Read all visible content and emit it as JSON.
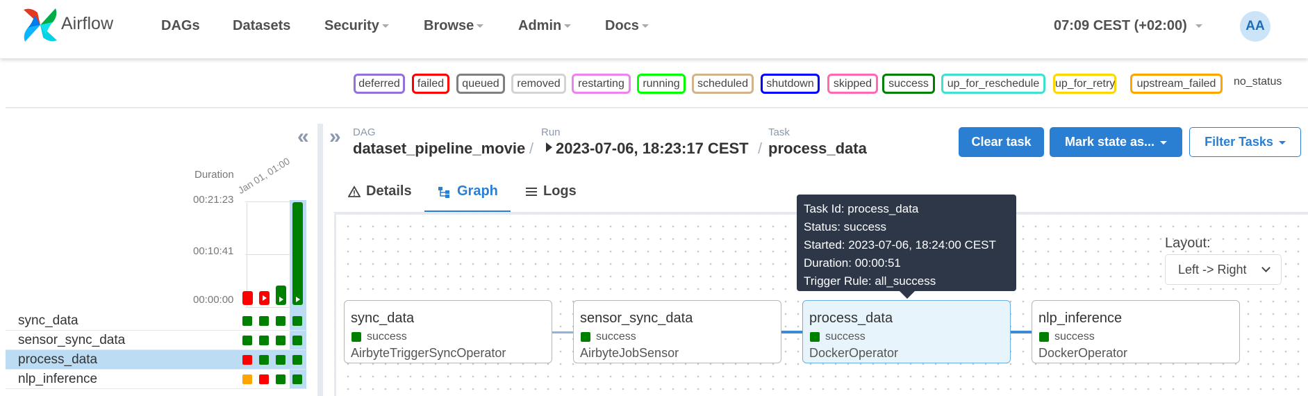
{
  "brand": {
    "name": "Airflow"
  },
  "nav": {
    "items": [
      {
        "label": "DAGs",
        "dropdown": false
      },
      {
        "label": "Datasets",
        "dropdown": false
      },
      {
        "label": "Security",
        "dropdown": true
      },
      {
        "label": "Browse",
        "dropdown": true
      },
      {
        "label": "Admin",
        "dropdown": true
      },
      {
        "label": "Docs",
        "dropdown": true
      }
    ],
    "clock": "07:09 CEST (+02:00)",
    "avatar_initials": "AA"
  },
  "legend": [
    {
      "label": "deferred",
      "color": "#9370db"
    },
    {
      "label": "failed",
      "color": "#ff0000"
    },
    {
      "label": "queued",
      "color": "#808080"
    },
    {
      "label": "removed",
      "color": "#d3d3d3"
    },
    {
      "label": "restarting",
      "color": "#ee82ee"
    },
    {
      "label": "running",
      "color": "#00ff00"
    },
    {
      "label": "scheduled",
      "color": "#d2b48c"
    },
    {
      "label": "shutdown",
      "color": "#0000ff"
    },
    {
      "label": "skipped",
      "color": "#ff69b4"
    },
    {
      "label": "success",
      "color": "#008000"
    },
    {
      "label": "up_for_reschedule",
      "color": "#40e0d0"
    },
    {
      "label": "up_for_retry",
      "color": "#ffd700"
    },
    {
      "label": "upstream_failed",
      "color": "#ffa500"
    },
    {
      "label": "no_status",
      "color": ""
    }
  ],
  "grid": {
    "duration_label": "Duration",
    "run_date_label": "Jan 01, 01:00",
    "ticks": [
      "00:21:23",
      "00:10:41",
      "00:00:00"
    ],
    "tasks": [
      {
        "name": "sync_data",
        "statuses": [
          "success",
          "success",
          "success",
          "success"
        ]
      },
      {
        "name": "sensor_sync_data",
        "statuses": [
          "success",
          "success",
          "success",
          "success"
        ]
      },
      {
        "name": "process_data",
        "statuses": [
          "failed",
          "success",
          "success",
          "success"
        ]
      },
      {
        "name": "nlp_inference",
        "statuses": [
          "upstream_failed",
          "failed",
          "success",
          "success"
        ]
      }
    ],
    "selected_task": "process_data",
    "status_colors": {
      "success": "#008000",
      "failed": "#ff0000",
      "upstream_failed": "#ffa500"
    }
  },
  "breadcrumb": {
    "dag_label": "DAG",
    "dag_value": "dataset_pipeline_movie",
    "run_label": "Run",
    "run_value": "2023-07-06, 18:23:17 CEST",
    "task_label": "Task",
    "task_value": "process_data"
  },
  "actions": {
    "clear": "Clear task",
    "mark": "Mark state as...",
    "filter": "Filter Tasks"
  },
  "tabs": [
    {
      "label": "Details",
      "icon": "warning-triangle-icon"
    },
    {
      "label": "Graph",
      "icon": "graph-icon",
      "active": true
    },
    {
      "label": "Logs",
      "icon": "list-lines-icon"
    }
  ],
  "graph": {
    "layout_label": "Layout:",
    "layout_value": "Left -> Right",
    "nodes": [
      {
        "title": "sync_data",
        "status": "success",
        "operator": "AirbyteTriggerSyncOperator"
      },
      {
        "title": "sensor_sync_data",
        "status": "success",
        "operator": "AirbyteJobSensor"
      },
      {
        "title": "process_data",
        "status": "success",
        "operator": "DockerOperator",
        "selected": true
      },
      {
        "title": "nlp_inference",
        "status": "success",
        "operator": "DockerOperator"
      }
    ],
    "tooltip": {
      "task_id": "Task Id: process_data",
      "status": "Status: success",
      "started": "Started: 2023-07-06, 18:24:00 CEST",
      "duration": "Duration: 00:00:51",
      "trigger_rule": "Trigger Rule: all_success"
    }
  }
}
